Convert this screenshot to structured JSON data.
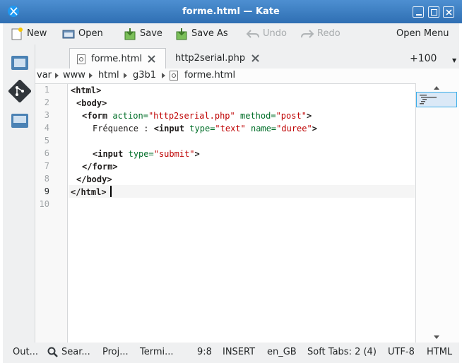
{
  "window": {
    "title": "forme.html  — Kate"
  },
  "toolbar": {
    "new": "New",
    "open": "Open",
    "save": "Save",
    "save_as": "Save As",
    "undo": "Undo",
    "redo": "Redo",
    "open_menu": "Open Menu"
  },
  "tabs": [
    {
      "label": "forme.html",
      "active": true
    },
    {
      "label": "http2serial.php",
      "active": false
    }
  ],
  "tabs_more": "+100",
  "breadcrumb": [
    "var",
    "www",
    "html",
    "g3b1",
    "forme.html"
  ],
  "editor": {
    "line_numbers": [
      "1",
      "2",
      "3",
      "4",
      "5",
      "6",
      "7",
      "8",
      "9",
      "10"
    ],
    "current_line": 9
  },
  "code": {
    "l1_tag": "<html>",
    "l2_tag": "<body>",
    "l3_tag": "<form",
    "l3_attr1": "action=",
    "l3_val1": "\"http2serial.php\"",
    "l3_attr2": "method=",
    "l3_val2": "\"post\"",
    "l3_close": ">",
    "l4_text": "Fréquence : ",
    "l4_tag": "<input",
    "l4_attr1": "type=",
    "l4_val1": "\"text\"",
    "l4_attr2": "name=",
    "l4_val2": "\"duree\"",
    "l4_close": ">",
    "l6_tag": "<input",
    "l6_attr1": "type=",
    "l6_val1": "\"submit\"",
    "l6_close": ">",
    "l7_tag": "</form>",
    "l8_tag": "</body>",
    "l9_tag": "</html>"
  },
  "status": {
    "output": "Out...",
    "search": "Sear...",
    "projects": "Proj...",
    "terminal": "Termi...",
    "cursor": "9:8",
    "mode": "INSERT",
    "language": "en_GB",
    "indent": "Soft Tabs: 2 (4)",
    "encoding": "UTF-8",
    "syntax": "HTML"
  },
  "colors": {
    "titlebar": "#3c7fc4",
    "tag": "#1f1c1b",
    "attribute": "#006e28",
    "value": "#bf0303",
    "focus": "#3daee9"
  }
}
